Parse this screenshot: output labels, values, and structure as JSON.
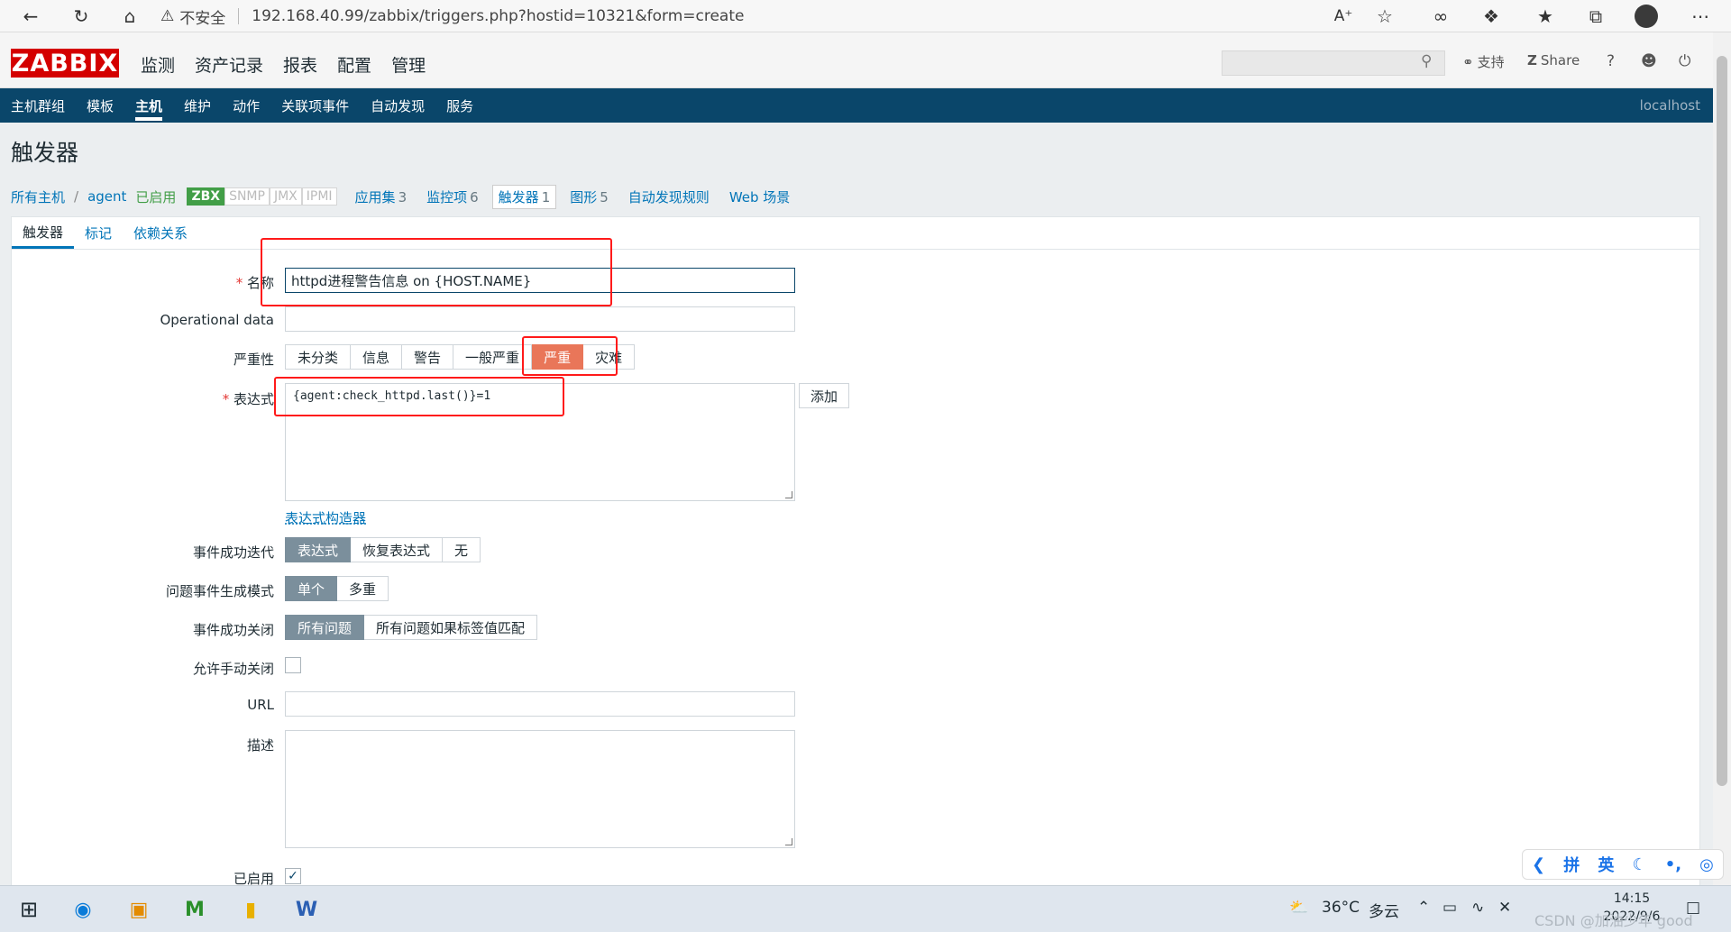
{
  "browser": {
    "insecure_label": "不安全",
    "url": "192.168.40.99/zabbix/triggers.php?hostid=10321&form=create"
  },
  "logo": "ZABBIX",
  "main_menu": [
    "监测",
    "资产记录",
    "报表",
    "配置",
    "管理"
  ],
  "top_right": {
    "support": "支持",
    "share": "Share",
    "help": "?"
  },
  "sub_nav": {
    "items": [
      "主机群组",
      "模板",
      "主机",
      "维护",
      "动作",
      "关联项事件",
      "自动发现",
      "服务"
    ],
    "active": "主机",
    "host": "localhost"
  },
  "page_title": "触发器",
  "breadcrumb": {
    "all_hosts": "所有主机",
    "host": "agent",
    "status": "已启用",
    "availability": [
      "ZBX",
      "SNMP",
      "JMX",
      "IPMI"
    ],
    "tabs": [
      {
        "label": "应用集",
        "count": "3"
      },
      {
        "label": "监控项",
        "count": "6"
      },
      {
        "label": "触发器",
        "count": "1"
      },
      {
        "label": "图形",
        "count": "5"
      },
      {
        "label": "自动发现规则",
        "count": ""
      },
      {
        "label": "Web 场景",
        "count": ""
      }
    ]
  },
  "form_tabs": [
    "触发器",
    "标记",
    "依赖关系"
  ],
  "form": {
    "name_label": "名称",
    "name_value": "httpd进程警告信息 on {HOST.NAME}",
    "opdata_label": "Operational data",
    "opdata_value": "",
    "severity_label": "严重性",
    "severity_options": [
      "未分类",
      "信息",
      "警告",
      "一般严重",
      "严重",
      "灾难"
    ],
    "severity_selected": "严重",
    "expression_label": "表达式",
    "expression_value": "{agent:check_httpd.last()}=1",
    "add_button": "添加",
    "expr_builder_link": "表达式构造器",
    "ok_event_label": "事件成功迭代",
    "ok_event_options": [
      "表达式",
      "恢复表达式",
      "无"
    ],
    "ok_event_selected": "表达式",
    "gen_mode_label": "问题事件生成模式",
    "gen_mode_options": [
      "单个",
      "多重"
    ],
    "gen_mode_selected": "单个",
    "ok_close_label": "事件成功关闭",
    "ok_close_options": [
      "所有问题",
      "所有问题如果标签值匹配"
    ],
    "ok_close_selected": "所有问题",
    "manual_close_label": "允许手动关闭",
    "url_label": "URL",
    "url_value": "",
    "desc_label": "描述",
    "desc_value": "",
    "enabled_label": "已启用"
  },
  "ime": [
    "拼",
    "英"
  ],
  "taskbar": {
    "temperature": "36°C",
    "weather": "多云",
    "time": "14:15",
    "date": "2022/9/6"
  },
  "watermark": "CSDN @加油少年 good"
}
